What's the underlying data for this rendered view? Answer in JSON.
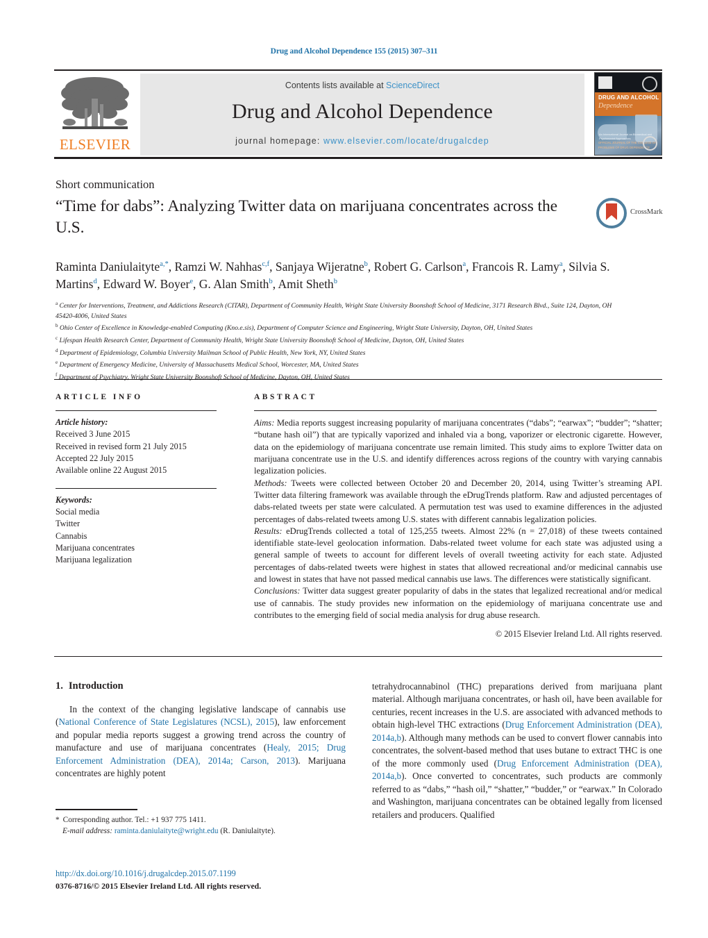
{
  "running_head": "Drug and Alcohol Dependence 155 (2015) 307–311",
  "colors": {
    "link_blue": "#1f72a8",
    "sciencedirect_blue": "#3c91c7",
    "elsevier_orange": "#ef7d22",
    "banner_grey": "#e7e7e7"
  },
  "masthead": {
    "contents_prefix": "Contents lists available at ",
    "contents_link": "ScienceDirect",
    "journal_title": "Drug and Alcohol Dependence",
    "homepage_prefix": "journal homepage: ",
    "homepage_url": "www.elsevier.com/locate/drugalcdep",
    "publisher_name": "ELSEVIER",
    "cover": {
      "title": "DRUG AND ALCOHOL",
      "subtitle": "Dependence",
      "caption": "An International Journal on Biomedical and Psychosocial Approaches",
      "footline": "OFFICIAL JOURNAL OF\nTHE COLLEGE ON PROBLEMS OF DRUG DEPENDENCE"
    }
  },
  "article": {
    "type_label": "Short communication",
    "title": "“Time for dabs”: Analyzing Twitter data on marijuana concentrates across the U.S.",
    "crossmark_label": "CrossMark",
    "authors_html": "Raminta Daniulaityte<sup>a,*</sup>, Ramzi W. Nahhas<sup>c,f</sup>, Sanjaya Wijeratne<sup>b</sup>, Robert G. Carlson<sup>a</sup>, Francois R. Lamy<sup>a</sup>, Silvia S. Martins<sup>d</sup>, Edward W. Boyer<sup>e</sup>, G. Alan Smith<sup>b</sup>, Amit Sheth<sup>b</sup>",
    "affiliations": [
      {
        "marker": "a",
        "text": "Center for Interventions, Treatment, and Addictions Research (CITAR), Department of Community Health, Wright State University Boonshoft School of Medicine, 3171 Research Blvd., Suite 124, Dayton, OH 45420-4006, United States"
      },
      {
        "marker": "b",
        "text": "Ohio Center of Excellence in Knowledge-enabled Computing (Kno.e.sis), Department of Computer Science and Engineering, Wright State University, Dayton, OH, United States"
      },
      {
        "marker": "c",
        "text": "Lifespan Health Research Center, Department of Community Health, Wright State University Boonshoft School of Medicine, Dayton, OH, United States"
      },
      {
        "marker": "d",
        "text": "Department of Epidemiology, Columbia University Mailman School of Public Health, New York, NY, United States"
      },
      {
        "marker": "e",
        "text": "Department of Emergency Medicine, University of Massachusetts Medical School, Worcester, MA, United States"
      },
      {
        "marker": "f",
        "text": "Department of Psychiatry, Wright State University Boonshoft School of Medicine, Dayton, OH, United States"
      }
    ]
  },
  "article_info": {
    "heading": "ARTICLE INFO",
    "history_label": "Article history:",
    "history": [
      "Received 3 June 2015",
      "Received in revised form 21 July 2015",
      "Accepted 22 July 2015",
      "Available online 22 August 2015"
    ],
    "keywords_label": "Keywords:",
    "keywords": [
      "Social media",
      "Twitter",
      "Cannabis",
      "Marijuana concentrates",
      "Marijuana legalization"
    ]
  },
  "abstract": {
    "heading": "ABSTRACT",
    "sections": [
      {
        "label": "Aims:",
        "text": " Media reports suggest increasing popularity of marijuana concentrates (“dabs”; “earwax”; “budder”; “shatter; “butane hash oil”) that are typically vaporized and inhaled via a bong, vaporizer or electronic cigarette. However, data on the epidemiology of marijuana concentrate use remain limited. This study aims to explore Twitter data on marijuana concentrate use in the U.S. and identify differences across regions of the country with varying cannabis legalization policies."
      },
      {
        "label": "Methods:",
        "text": " Tweets were collected between October 20 and December 20, 2014, using Twitter’s streaming API. Twitter data filtering framework was available through the eDrugTrends platform. Raw and adjusted percentages of dabs-related tweets per state were calculated. A permutation test was used to examine differences in the adjusted percentages of dabs-related tweets among U.S. states with different cannabis legalization policies."
      },
      {
        "label": "Results:",
        "text": " eDrugTrends collected a total of 125,255 tweets. Almost 22% (n = 27,018) of these tweets contained identifiable state-level geolocation information. Dabs-related tweet volume for each state was adjusted using a general sample of tweets to account for different levels of overall tweeting activity for each state. Adjusted percentages of dabs-related tweets were highest in states that allowed recreational and/or medicinal cannabis use and lowest in states that have not passed medical cannabis use laws. The differences were statistically significant."
      },
      {
        "label": "Conclusions:",
        "text": " Twitter data suggest greater popularity of dabs in the states that legalized recreational and/or medical use of cannabis. The study provides new information on the epidemiology of marijuana concentrate use and contributes to the emerging field of social media analysis for drug abuse research."
      }
    ],
    "copyright": "© 2015 Elsevier Ireland Ltd. All rights reserved."
  },
  "introduction": {
    "number": "1.",
    "heading": "Introduction",
    "left_paragraph_parts": [
      {
        "t": "In the context of the changing legislative landscape of cannabis use (",
        "link": false
      },
      {
        "t": "National Conference of State Legislatures (NCSL), 2015",
        "link": true
      },
      {
        "t": "), law enforcement and popular media reports suggest a growing trend across the country of manufacture and use of marijuana concentrates (",
        "link": false
      },
      {
        "t": "Healy, 2015; Drug Enforcement Administration (DEA), 2014a; Carson, 2013",
        "link": true
      },
      {
        "t": "). Marijuana concentrates are highly potent",
        "link": false
      }
    ],
    "right_paragraph_parts": [
      {
        "t": "tetrahydrocannabinol (THC) preparations derived from marijuana plant material. Although marijuana concentrates, or hash oil, have been available for centuries, recent increases in the U.S. are associated with advanced methods to obtain high-level THC extractions (",
        "link": false
      },
      {
        "t": "Drug Enforcement Administration (DEA), 2014a,b",
        "link": true
      },
      {
        "t": "). Although many methods can be used to convert flower cannabis into concentrates, the solvent-based method that uses butane to extract THC is one of the more commonly used (",
        "link": false
      },
      {
        "t": "Drug Enforcement Administration (DEA), 2014a,b",
        "link": true
      },
      {
        "t": "). Once converted to concentrates, such products are commonly referred to as “dabs,” “hash oil,” “shatter,” “budder,” or “earwax.” In Colorado and Washington, marijuana concentrates can be obtained legally from licensed retailers and producers. Qualified",
        "link": false
      }
    ]
  },
  "footnote": {
    "star": "*",
    "corresponding": "Corresponding author. Tel.: +1 937 775 1411.",
    "email_label": "E-mail address:",
    "email": "raminta.daniulaityte@wright.edu",
    "email_suffix": "(R. Daniulaityte)."
  },
  "footer": {
    "doi": "http://dx.doi.org/10.1016/j.drugalcdep.2015.07.1199",
    "issn": "0376-8716/© 2015 Elsevier Ireland Ltd. All rights reserved."
  }
}
